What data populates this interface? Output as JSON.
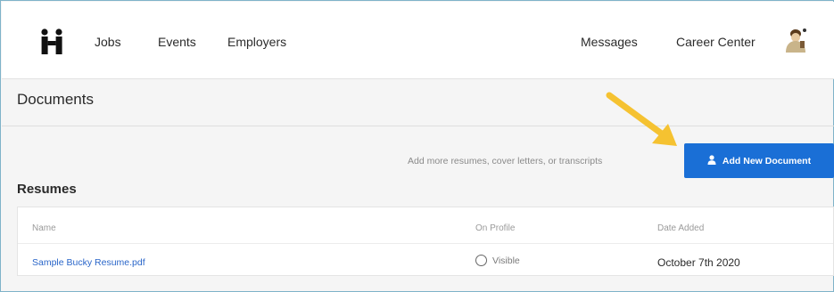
{
  "nav": {
    "links": [
      "Jobs",
      "Events",
      "Employers"
    ],
    "right_links": [
      "Messages",
      "Career Center"
    ]
  },
  "page": {
    "title": "Documents",
    "helper_text": "Add more resumes, cover letters, or transcripts",
    "add_button_label": "Add New Document"
  },
  "resumes": {
    "title": "Resumes",
    "columns": [
      "Name",
      "On Profile",
      "Date Added"
    ],
    "rows": [
      {
        "name": "Sample Bucky Resume.pdf",
        "on_profile": "Visible",
        "date_added": "October 7th 2020"
      }
    ]
  },
  "colors": {
    "accent": "#1a6fd6",
    "annotation_arrow": "#f5c231",
    "link": "#2a66c9"
  },
  "icons": {
    "logo": "handshake-logo-icon",
    "avatar": "user-avatar-icon",
    "upload": "upload-icon",
    "radio": "radio-unchecked-icon",
    "annotation": "arrow-annotation-icon"
  }
}
